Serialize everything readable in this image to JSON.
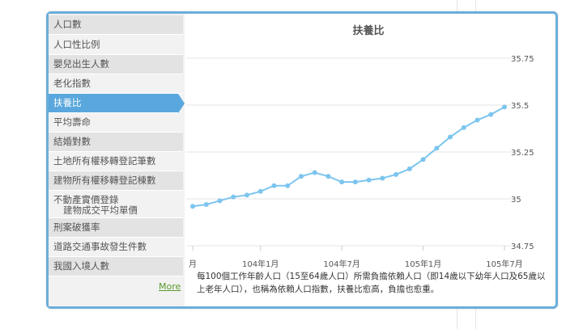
{
  "sidebar": {
    "items": [
      {
        "label": "人口數"
      },
      {
        "label": "人口性比例"
      },
      {
        "label": "嬰兒出生人數"
      },
      {
        "label": "老化指數"
      },
      {
        "label": "扶養比"
      },
      {
        "label": "平均壽命"
      },
      {
        "label": "結婚對數"
      },
      {
        "label": "土地所有權移轉登記筆數"
      },
      {
        "label": "建物所有權移轉登記棟數"
      },
      {
        "label": "不動產實價登錄",
        "label2": "建物成交平均單價"
      },
      {
        "label": "刑案破獲率"
      },
      {
        "label": "道路交通事故發生件數"
      },
      {
        "label": "我國入境人數"
      }
    ],
    "active_index": 4,
    "more_label": "More"
  },
  "description": "每100個工作年齡人口（15至64歲人口）所需負擔依賴人口（即14歲以下幼年人口及65歲以上老年人口），也稱為依賴人口指數，扶養比愈高，負擔也愈重。",
  "colors": {
    "accent": "#6aaedb",
    "line": "#7cc5ee",
    "active": "#5aa7dd"
  },
  "chart_data": {
    "type": "line",
    "title": "扶養比",
    "x_ticks": [
      "月",
      "104年1月",
      "104年7月",
      "105年1月",
      "105年7月"
    ],
    "x_tick_index": [
      0,
      5,
      11,
      17,
      23
    ],
    "y_ticks": [
      "35.75",
      "35.5",
      "35.25",
      "35",
      "34.75"
    ],
    "ylim": [
      34.75,
      35.75
    ],
    "grid": "horizontal",
    "series": [
      {
        "values": [
          34.96,
          34.97,
          34.99,
          35.01,
          35.02,
          35.04,
          35.07,
          35.07,
          35.12,
          35.14,
          35.12,
          35.09,
          35.09,
          35.1,
          35.11,
          35.13,
          35.16,
          35.21,
          35.27,
          35.33,
          35.38,
          35.42,
          35.45,
          35.49
        ]
      }
    ]
  }
}
